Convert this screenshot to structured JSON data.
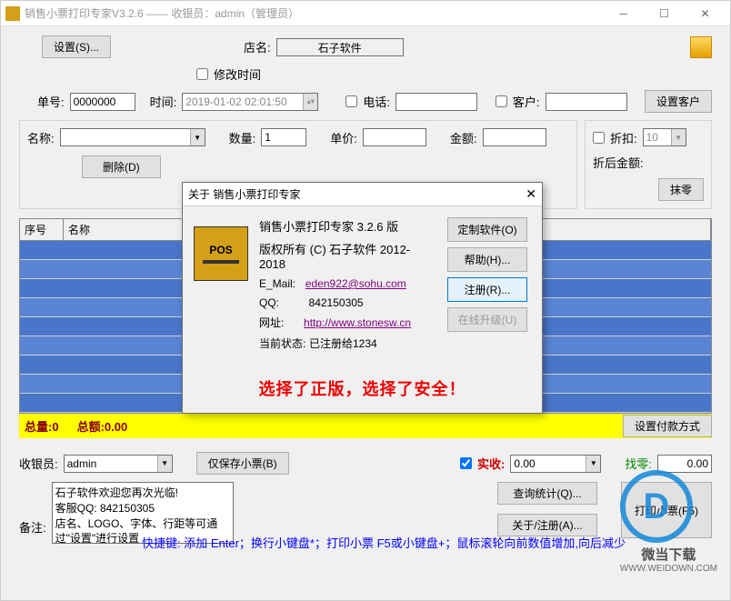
{
  "window": {
    "title": "销售小票打印专家V3.2.6 —— 收银员：admin（管理员）"
  },
  "toolbar": {
    "settings_btn": "设置(S)...",
    "shop_label": "店名:",
    "shop_value": "石子软件"
  },
  "edit_time": {
    "checkbox_label": "修改时间"
  },
  "row2": {
    "order_label": "单号:",
    "order_value": "0000000",
    "time_label": "时间:",
    "time_value": "2019-01-02 02:01:50",
    "phone_label": "电话:",
    "customer_label": "客户:",
    "set_customer_btn": "设置客户"
  },
  "row3": {
    "name_label": "名称:",
    "qty_label": "数量:",
    "qty_value": "1",
    "price_label": "单价:",
    "amount_label": "金额:",
    "discount_label": "折扣:",
    "discount_value": "10",
    "after_discount_label": "折后金额:",
    "delete_btn": "删除(D)",
    "wipe_btn": "抹零"
  },
  "table": {
    "col1": "序号",
    "col2": "名称"
  },
  "totals": {
    "qty_label": "总量:0",
    "amount_label": "总额:0.00",
    "pay_method_btn": "设置付款方式"
  },
  "bottom": {
    "cashier_label": "收银员:",
    "cashier_value": "admin",
    "save_only_btn": "仅保存小票(B)",
    "actual_label": "实收:",
    "actual_value": "0.00",
    "change_label": "找零:",
    "change_value": "0.00",
    "remark_label": "备注:",
    "remark_text": "石子软件欢迎您再次光临!\n客服QQ: 842150305\n店名、LOGO、字体、行距等可通过\"设置\"进行设置",
    "query_btn": "查询统计(Q)...",
    "about_btn": "关于/注册(A)...",
    "print_btn": "打印小票(F5)"
  },
  "footer": {
    "text": "快捷键:    添加 Enter；换行小键盘*；打印小票 F5或小键盘+；鼠标滚轮向前数值增加,向后减少"
  },
  "dialog": {
    "title": "关于 销售小票打印专家",
    "line1": "销售小票打印专家 3.2.6 版",
    "line2": "版权所有 (C) 石子软件 2012-2018",
    "email_label": "E_Mail:",
    "email_value": "eden922@sohu.com",
    "qq_label": "QQ:",
    "qq_value": "842150305",
    "url_label": "网址:",
    "url_value": "http://www.stonesw.cn",
    "status_label": "当前状态:",
    "status_value": "已注册给1234",
    "slogan": "选择了正版，选择了安全！",
    "pos_label": "POS",
    "btn_custom": "定制软件(O)",
    "btn_help": "帮助(H)...",
    "btn_register": "注册(R)...",
    "btn_upgrade": "在线升级(U)"
  },
  "watermark": {
    "text": "微当下载",
    "url": "WWW.WEIDOWN.COM"
  }
}
